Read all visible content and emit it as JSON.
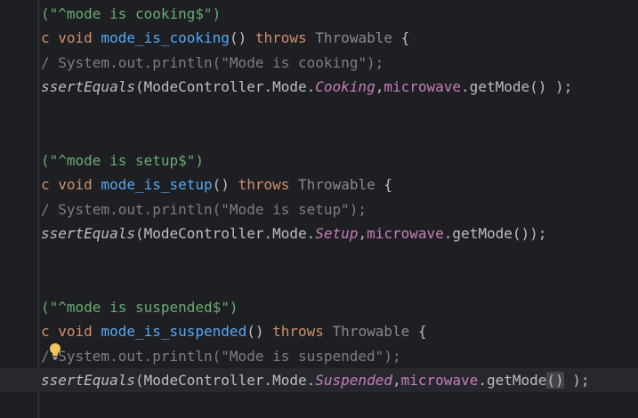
{
  "editor": {
    "lines": [
      {
        "id": "l0",
        "tokens": [
          {
            "t": "(\"^mode is cooking$\")",
            "c": "str"
          }
        ]
      },
      {
        "id": "l1",
        "tokens": [
          {
            "t": "c ",
            "c": "kw"
          },
          {
            "t": "void ",
            "c": "kw"
          },
          {
            "t": "mode_is_cooking",
            "c": "fn"
          },
          {
            "t": "() ",
            "c": "pn"
          },
          {
            "t": "throws ",
            "c": "kw"
          },
          {
            "t": "Throwable",
            "c": "type"
          },
          {
            "t": " {",
            "c": "pn"
          }
        ]
      },
      {
        "id": "l2",
        "tokens": [
          {
            "t": "/ System.out.println(\"Mode is cooking\");",
            "c": "cm"
          }
        ]
      },
      {
        "id": "l3",
        "tokens": [
          {
            "t": "ssertEquals",
            "c": "call"
          },
          {
            "t": "(ModeController.Mode.",
            "c": "pn"
          },
          {
            "t": "Cooking",
            "c": "en"
          },
          {
            "t": ",",
            "c": "pn"
          },
          {
            "t": "microwave",
            "c": "fld"
          },
          {
            "t": ".getMode() );",
            "c": "pn"
          }
        ]
      },
      {
        "id": "l4",
        "tokens": []
      },
      {
        "id": "l5",
        "tokens": []
      },
      {
        "id": "l6",
        "tokens": [
          {
            "t": "(\"^mode is setup$\")",
            "c": "str"
          }
        ]
      },
      {
        "id": "l7",
        "tokens": [
          {
            "t": "c ",
            "c": "kw"
          },
          {
            "t": "void ",
            "c": "kw"
          },
          {
            "t": "mode_is_setup",
            "c": "fn"
          },
          {
            "t": "() ",
            "c": "pn"
          },
          {
            "t": "throws ",
            "c": "kw"
          },
          {
            "t": "Throwable",
            "c": "type"
          },
          {
            "t": " {",
            "c": "pn"
          }
        ]
      },
      {
        "id": "l8",
        "tokens": [
          {
            "t": "/ System.out.println(\"Mode is setup\");",
            "c": "cm"
          }
        ]
      },
      {
        "id": "l9",
        "tokens": [
          {
            "t": "ssertEquals",
            "c": "call"
          },
          {
            "t": "(ModeController.Mode.",
            "c": "pn"
          },
          {
            "t": "Setup",
            "c": "en"
          },
          {
            "t": ",",
            "c": "pn"
          },
          {
            "t": "microwave",
            "c": "fld"
          },
          {
            "t": ".getMode());",
            "c": "pn"
          }
        ]
      },
      {
        "id": "l10",
        "tokens": []
      },
      {
        "id": "l11",
        "tokens": []
      },
      {
        "id": "l12",
        "tokens": [
          {
            "t": "(\"^mode is suspended$\")",
            "c": "str"
          }
        ]
      },
      {
        "id": "l13",
        "tokens": [
          {
            "t": "c ",
            "c": "kw"
          },
          {
            "t": "void ",
            "c": "kw"
          },
          {
            "t": "mode_is_suspended",
            "c": "fn"
          },
          {
            "t": "() ",
            "c": "pn"
          },
          {
            "t": "throws ",
            "c": "kw"
          },
          {
            "t": "Throwable",
            "c": "type"
          },
          {
            "t": " {",
            "c": "pn"
          }
        ]
      },
      {
        "id": "l14",
        "tokens": [
          {
            "t": "/ System.out.println(\"Mode is suspended\");",
            "c": "cm"
          }
        ]
      },
      {
        "id": "l15",
        "current": true,
        "tokens": [
          {
            "t": "ssertEquals",
            "c": "call"
          },
          {
            "t": "(ModeController.Mode.",
            "c": "pn"
          },
          {
            "t": "Suspended",
            "c": "en"
          },
          {
            "t": ",",
            "c": "pn"
          },
          {
            "t": "microwave",
            "c": "fld"
          },
          {
            "t": ".getMode",
            "c": "pn"
          },
          {
            "t": "()",
            "c": "pn matched"
          },
          {
            "t": " );",
            "c": "pn"
          }
        ]
      }
    ],
    "colors": {
      "background": "#1e1f22",
      "current_line": "#26282e",
      "string": "#6aab73",
      "keyword": "#cf8e6d",
      "function": "#56a8f5",
      "type": "#868a91",
      "comment": "#7a7e85",
      "enum_constant": "#c77dbb",
      "text": "#bcbec4"
    },
    "intention_icon": "lightbulb-icon"
  }
}
